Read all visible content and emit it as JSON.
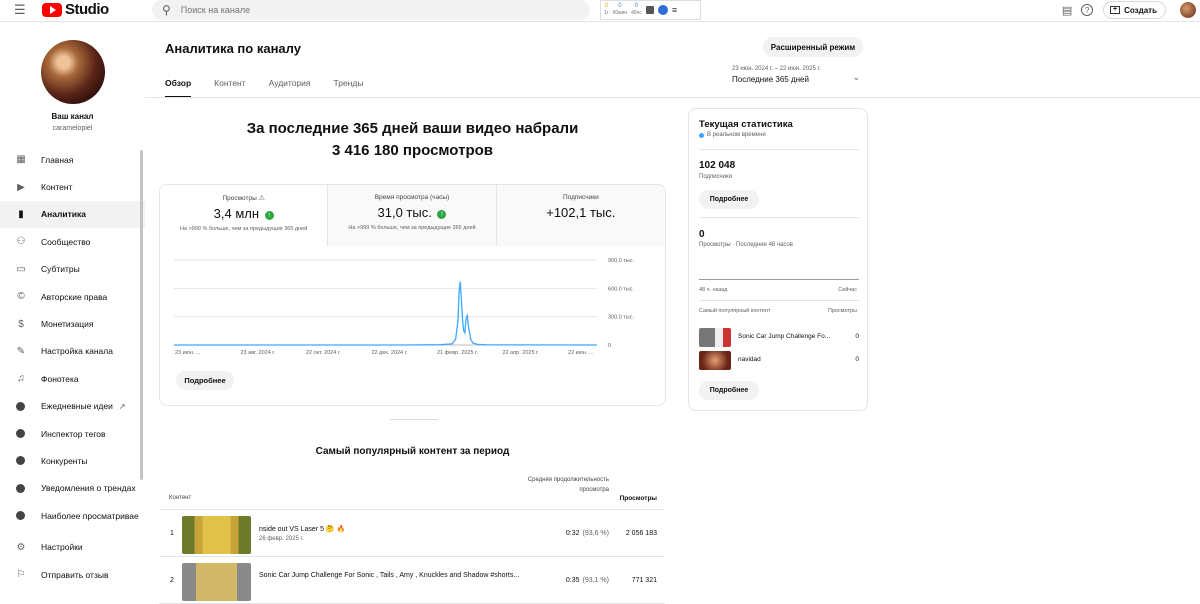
{
  "topbar": {
    "logo_text": "Studio",
    "search_placeholder": "Поиск на канале",
    "extension": {
      "c1": "0",
      "c1_label": "1г",
      "c2": "0",
      "c2_label": "60мин",
      "c3": "0",
      "c3_label": "48чс"
    },
    "create_label": "Создать"
  },
  "channel": {
    "title": "Ваш канал",
    "handle": "caramelopiel"
  },
  "sidebar": {
    "items": [
      {
        "label": "Главная",
        "icon": "dashboard-icon"
      },
      {
        "label": "Контент",
        "icon": "content-icon"
      },
      {
        "label": "Аналитика",
        "icon": "analytics-icon",
        "active": true
      },
      {
        "label": "Сообщество",
        "icon": "community-icon"
      },
      {
        "label": "Субтитры",
        "icon": "subtitles-icon"
      },
      {
        "label": "Авторские права",
        "icon": "copyright-icon"
      },
      {
        "label": "Монетизация",
        "icon": "monetization-icon"
      },
      {
        "label": "Настройка канала",
        "icon": "customization-icon"
      },
      {
        "label": "Фонотека",
        "icon": "audio-library-icon"
      },
      {
        "label": "Ежедневные идеи",
        "icon": "ext-icon"
      },
      {
        "label": "Инспектор тегов",
        "icon": "ext-icon"
      },
      {
        "label": "Конкуренты",
        "icon": "ext-icon"
      },
      {
        "label": "Уведомления о трендах",
        "icon": "ext-icon"
      },
      {
        "label": "Наиболее просматриваемые",
        "icon": "ext-icon"
      },
      {
        "label": "Настройки",
        "icon": "settings-icon"
      },
      {
        "label": "Отправить отзыв",
        "icon": "feedback-icon"
      }
    ]
  },
  "main": {
    "title": "Аналитика по каналу",
    "advanced_button": "Расширенный режим",
    "tabs": [
      "Обзор",
      "Контент",
      "Аудитория",
      "Тренды"
    ],
    "period_range": "23 июн. 2024 г. – 22 июн. 2025 г.",
    "period_label": "Последние 365 дней",
    "headline_line1": "За последние 365 дней ваши видео набрали",
    "headline_line2": "3 416 180 просмотров",
    "metrics": [
      {
        "label": "Просмотры",
        "value": "3,4 млн",
        "sub": "На >999 % больше, чем за предыдущие 365 дней"
      },
      {
        "label": "Время просмотра (часы)",
        "value": "31,0 тыс.",
        "sub": "На >999 % больше, чем за предыдущие 365 дней"
      },
      {
        "label": "Подписчики",
        "value": "+102,1 тыс.",
        "sub": ""
      }
    ],
    "more_label": "Подробнее",
    "top_content_title": "Самый популярный контент за период",
    "table": {
      "col_content": "Контент",
      "col_avg": "Средняя продолжительность просмотра",
      "col_views": "Просмотры",
      "rows": [
        {
          "n": "1",
          "title": "nside out VS Laser 5 🤔 🔥",
          "date": "26 февр. 2025 г.",
          "avg": "0:32",
          "pct": "(93,6 %)",
          "views": "2 056 183"
        },
        {
          "n": "2",
          "title": "Sonic Car Jump Challenge For Sonic , Tails , Amy , Knuckles and Shadow #shorts...",
          "date": "",
          "avg": "0:35",
          "pct": "(93,1 %)",
          "views": "771 321"
        }
      ]
    }
  },
  "chart_data": {
    "type": "line",
    "title": "",
    "xlabel": "",
    "ylabel": "",
    "x_tick_labels": [
      "23 июн. ...",
      "23 авг. 2024 г.",
      "22 окт. 2024 г.",
      "22 дек. 2024 г.",
      "21 февр. 2025 г.",
      "22 апр. 2025 г.",
      "22 июн. ..."
    ],
    "y_tick_labels": [
      "0",
      "300,0 тыс.",
      "600,0 тыс.",
      "900,0 тыс."
    ],
    "ylim": [
      0,
      900000
    ],
    "x_days": 365,
    "series": [
      {
        "name": "",
        "color": "#3ea6ff",
        "points": [
          [
            0,
            0
          ],
          [
            200,
            0
          ],
          [
            230,
            3000
          ],
          [
            240,
            12000
          ],
          [
            243,
            60000
          ],
          [
            245,
            250000
          ],
          [
            246,
            560000
          ],
          [
            247,
            670000
          ],
          [
            248,
            480000
          ],
          [
            249,
            260000
          ],
          [
            250,
            150000
          ],
          [
            251,
            130000
          ],
          [
            252,
            280000
          ],
          [
            253,
            310000
          ],
          [
            254,
            200000
          ],
          [
            256,
            60000
          ],
          [
            258,
            20000
          ],
          [
            262,
            6000
          ],
          [
            270,
            2000
          ],
          [
            300,
            1000
          ],
          [
            365,
            500
          ]
        ]
      }
    ],
    "grid": true
  },
  "realtime": {
    "title": "Текущая статистика",
    "live": "В реальном времени",
    "subs_value": "102 048",
    "subs_label": "Подписчики",
    "views_value": "0",
    "views_label": "Просмотры · Последние 48 часов",
    "axis_left": "48 ч. назад",
    "axis_right": "Сейчас",
    "pop_left": "Самый популярный контент",
    "pop_right": "Просмотры",
    "rows": [
      {
        "title": "Sonic Car Jump Challenge Fo...",
        "views": "0"
      },
      {
        "title": "navidad",
        "views": "0"
      }
    ],
    "more_label": "Подробнее"
  }
}
